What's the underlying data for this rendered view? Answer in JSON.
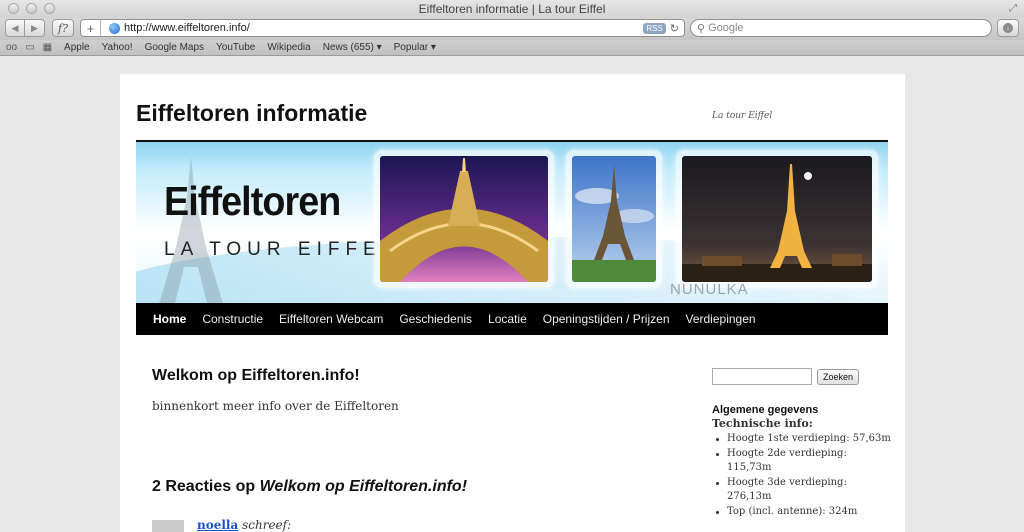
{
  "window": {
    "title": "Eiffeltoren informatie | La tour Eiffel"
  },
  "toolbar": {
    "url": "http://www.eiffeltoren.info/",
    "rss_label": "RSS",
    "search_placeholder": "Google"
  },
  "bookmarks": [
    "Apple",
    "Yahoo!",
    "Google Maps",
    "YouTube",
    "Wikipedia",
    "News (655) ▾",
    "Popular ▾"
  ],
  "site": {
    "title": "Eiffeltoren informatie",
    "description": "La tour Eiffel"
  },
  "banner": {
    "brand": "Eiffeltoren",
    "subtitle": "LA TOUR EIFFEL",
    "watermark": "NUNULKA"
  },
  "nav": [
    {
      "label": "Home",
      "active": true
    },
    {
      "label": "Constructie",
      "active": false
    },
    {
      "label": "Eiffeltoren Webcam",
      "active": false
    },
    {
      "label": "Geschiedenis",
      "active": false
    },
    {
      "label": "Locatie",
      "active": false
    },
    {
      "label": "Openingstijden / Prijzen",
      "active": false
    },
    {
      "label": "Verdiepingen",
      "active": false
    }
  ],
  "post": {
    "title": "Welkom op Eiffeltoren.info!",
    "body": "binnenkort meer info over de Eiffeltoren"
  },
  "comments": {
    "heading_prefix": "2 Reacties op ",
    "heading_post": "Welkom op Eiffeltoren.info!",
    "first_author": "noella",
    "first_says": "schreef:"
  },
  "sidebar": {
    "search_button": "Zoeken",
    "widget_title": "Algemene gegevens",
    "widget_subtitle": "Technische info:",
    "items": [
      "Hoogte 1ste verdieping: 57,63m",
      "Hoogte 2de verdieping: 115,73m",
      "Hoogte 3de verdieping: 276,13m",
      "Top (incl. antenne): 324m"
    ]
  }
}
